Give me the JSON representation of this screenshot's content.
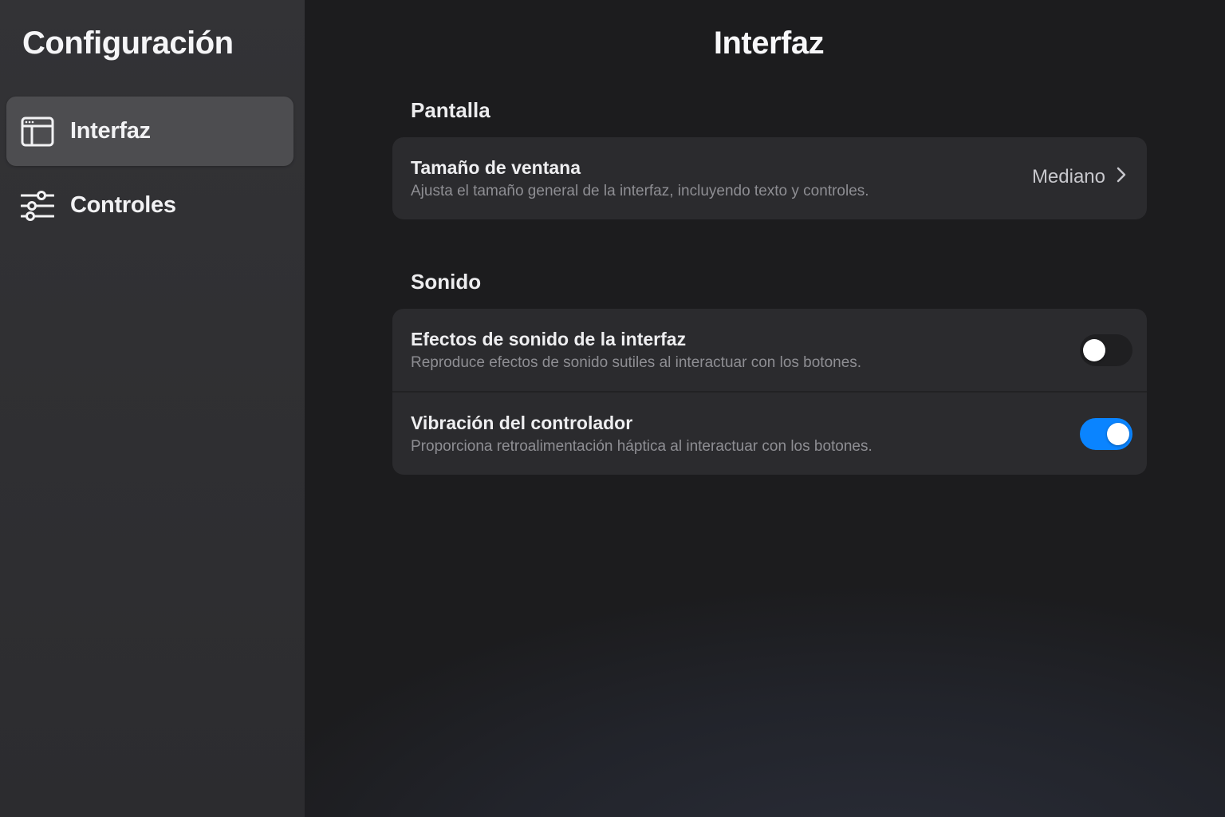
{
  "sidebar": {
    "title": "Configuración",
    "items": [
      {
        "label": "Interfaz",
        "icon": "window-layout-icon",
        "active": true
      },
      {
        "label": "Controles",
        "icon": "sliders-icon",
        "active": false
      }
    ]
  },
  "main": {
    "title": "Interfaz",
    "sections": [
      {
        "header": "Pantalla",
        "rows": [
          {
            "title": "Tamaño de ventana",
            "subtitle": "Ajusta el tamaño general de la interfaz, incluyendo texto y controles.",
            "value": "Mediano"
          }
        ]
      },
      {
        "header": "Sonido",
        "rows": [
          {
            "title": "Efectos de sonido de la interfaz",
            "subtitle": "Reproduce efectos de sonido sutiles al interactuar con los botones.",
            "toggle": false
          },
          {
            "title": "Vibración del controlador",
            "subtitle": "Proporciona retroalimentación háptica al interactuar con los botones.",
            "toggle": true
          }
        ]
      }
    ]
  },
  "colors": {
    "accent": "#0a84ff",
    "sidebar_bg": "#313134",
    "main_bg": "#1c1c1e",
    "card_bg": "#2b2b2e",
    "active_item_bg": "#4d4d50",
    "secondary_text": "#8e8e93"
  }
}
